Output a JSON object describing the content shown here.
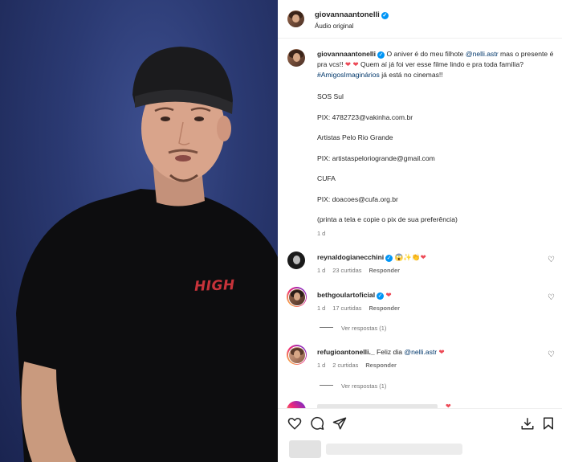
{
  "post": {
    "author": "giovannaantonelli",
    "audio": "Áudio original",
    "caption": {
      "author": "giovannaantonelli",
      "text_1": " O aniver é do meu filhote ",
      "mention": "@nelli.astr",
      "text_2": " mas o presente é pra vcs!! ",
      "text_3": " Quem aí já foi ver esse filme lindo e pra toda família? ",
      "hashtag": "#AmigosImaginários",
      "text_4": " já está no cinemas!!",
      "lines": [
        "SOS Sul",
        "PIX: 4782723@vakinha.com.br",
        "Artistas Pelo Rio Grande",
        "PIX: artistaspeloriogrande@gmail.com",
        "CUFA",
        "PIX: doacoes@cufa.org.br",
        "(printa a tela e copie o pix de sua preferência)"
      ],
      "time": "1 d"
    },
    "shirt_text": "HIGH"
  },
  "comments": [
    {
      "user": "reynaldogianecchini",
      "text": "",
      "emoji": "😱✨👏",
      "time": "1 d",
      "likes": "23 curtidas",
      "reply": "Responder"
    },
    {
      "user": "bethgoulartoficial",
      "text": "",
      "emoji": "",
      "time": "1 d",
      "likes": "17 curtidas",
      "reply": "Responder",
      "view_replies": "Ver respostas (1)"
    },
    {
      "user": "refugioantonelli._",
      "text": " Feliz dia ",
      "mention": "@nelli.astr",
      "time": "1 d",
      "likes": "2 curtidas",
      "reply": "Responder",
      "view_replies": "Ver respostas (1)"
    }
  ],
  "icons": {
    "verified": "verified-badge-icon",
    "like": "heart-outline-icon",
    "comment": "comment-icon",
    "share": "paper-plane-icon",
    "download": "download-icon",
    "save": "bookmark-icon"
  },
  "colors": {
    "verified_blue": "#0095f6",
    "link": "#00376b",
    "heart_red": "#ed4956",
    "muted": "#737373"
  }
}
